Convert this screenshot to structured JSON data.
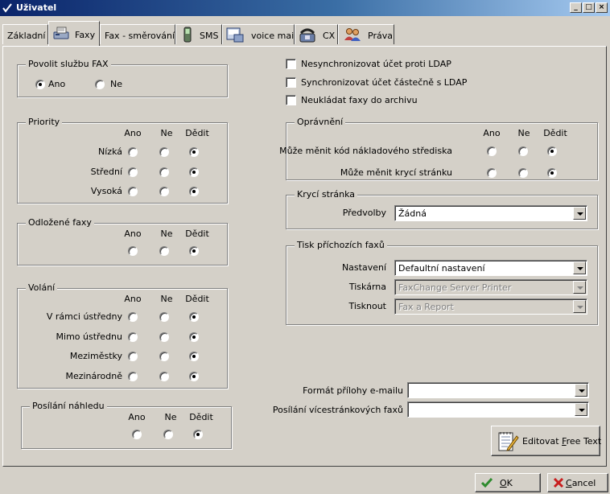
{
  "window": {
    "title": "Uživatel",
    "controls": {
      "minimize": "_",
      "maximize": "□",
      "close": "×"
    }
  },
  "tabs": [
    {
      "label": "Základní",
      "icon": "none"
    },
    {
      "label": "Faxy",
      "icon": "fax-icon",
      "active": true
    },
    {
      "label": "Fax - směrování",
      "icon": "none"
    },
    {
      "label": "SMS",
      "icon": "mobile-phone-icon"
    },
    {
      "label": "voice mail",
      "icon": "voicemail-icon"
    },
    {
      "label": "CX",
      "icon": "phone-icon"
    },
    {
      "label": "Práva",
      "icon": "users-icon"
    }
  ],
  "fax_service": {
    "title": "Povolit službu FAX",
    "yes": "Ano",
    "no": "Ne",
    "selected": "Ano"
  },
  "columns": {
    "yes": "Ano",
    "no": "Ne",
    "inherit": "Dědit"
  },
  "priority": {
    "title": "Priority",
    "rows": [
      {
        "label": "Nízká",
        "selected": "Dědit"
      },
      {
        "label": "Střední",
        "selected": "Dědit"
      },
      {
        "label": "Vysoká",
        "selected": "Dědit"
      }
    ]
  },
  "delayed": {
    "title": "Odložené faxy",
    "selected": "Dědit"
  },
  "calls": {
    "title": "Volání",
    "rows": [
      {
        "label": "V rámci ústředny",
        "selected": "Dědit"
      },
      {
        "label": "Mimo ústřednu",
        "selected": "Dědit"
      },
      {
        "label": "Meziměstky",
        "selected": "Dědit"
      },
      {
        "label": "Mezinárodně",
        "selected": "Dědit"
      }
    ]
  },
  "preview": {
    "title": "Posílání náhledu",
    "selected": "Dědit"
  },
  "checkboxes": [
    {
      "label": "Nesynchronizovat účet proti LDAP",
      "checked": false
    },
    {
      "label": "Synchronizovat účet částečně s LDAP",
      "checked": false
    },
    {
      "label": "Neukládat faxy do archivu",
      "checked": false
    }
  ],
  "permissions": {
    "title": "Oprávnění",
    "rows": [
      {
        "label": "Může měnit kód nákladového střediska",
        "selected": "Dědit"
      },
      {
        "label": "Může měnit krycí stránku",
        "selected": "Dědit"
      }
    ]
  },
  "cover_page": {
    "title": "Krycí stránka",
    "preset_label": "Předvolby",
    "preset_value": "Žádná"
  },
  "incoming_print": {
    "title": "Tisk příchozích faxů",
    "settings_label": "Nastavení",
    "settings_value": "Defaultní nastavení",
    "printer_label": "Tiskárna",
    "printer_value": "FaxChange Server Printer",
    "print_label": "Tisknout",
    "print_value": "Fax a Report"
  },
  "email_format": {
    "label": "Formát přílohy e-mailu",
    "value": ""
  },
  "multipage": {
    "label": "Posílání vícestránkových faxů",
    "value": ""
  },
  "buttons": {
    "edit_free_text": {
      "prefix": "Editovat ",
      "hotkey": "F",
      "rest": "ree Text"
    },
    "ok": {
      "hotkey": "O",
      "rest": "K"
    },
    "cancel": {
      "hotkey": "C",
      "rest": "ancel"
    }
  },
  "colors": {
    "titlebar": "#0a246a",
    "face": "#d4d0c8",
    "ok_check": "#2e8b2e",
    "cancel_x": "#c81e1e"
  }
}
